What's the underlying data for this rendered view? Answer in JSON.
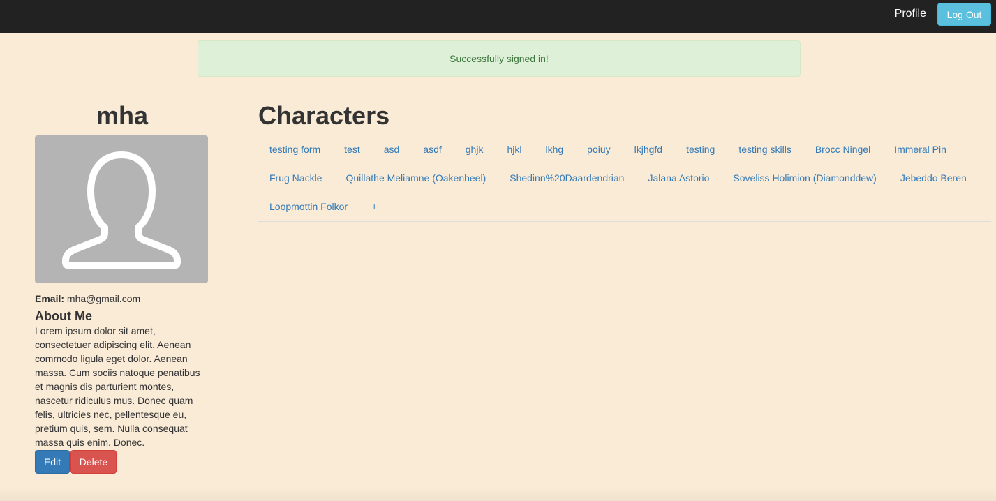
{
  "navbar": {
    "profile_label": "Profile",
    "logout_label": "Log Out"
  },
  "alert": {
    "message": "Successfully signed in!"
  },
  "profile": {
    "username": "mha",
    "email_label": "Email:",
    "email": "mha@gmail.com",
    "about_title": "About Me",
    "about_text": "Lorem ipsum dolor sit amet, consectetuer adipiscing elit. Aenean commodo ligula eget dolor. Aenean massa. Cum sociis natoque penatibus et magnis dis parturient montes, nascetur ridiculus mus. Donec quam felis, ultricies nec, pellentesque eu, pretium quis, sem. Nulla consequat massa quis enim. Donec.",
    "edit_label": "Edit",
    "delete_label": "Delete",
    "avatar_icon": "user-silhouette-icon"
  },
  "characters": {
    "title": "Characters",
    "tabs": [
      "testing form",
      "test",
      "asd",
      "asdf",
      "ghjk",
      "hjkl",
      "lkhg",
      "poiuy",
      "lkjhgfd",
      "testing",
      "testing skills",
      "Brocc Ningel",
      "Immeral Pin",
      "Frug Nackle",
      "Quillathe Meliamne (Oakenheel)",
      "Shedinn%20Daardendrian",
      "Jalana Astorio",
      "Soveliss Holimion (Diamonddew)",
      "Jebeddo Beren",
      "Loopmottin Folkor"
    ],
    "add_label": "+"
  },
  "colors": {
    "page_background": "#faebd7",
    "navbar": "#222222",
    "link": "#337ab7",
    "info_button": "#5bc0de",
    "primary_button": "#337ab7",
    "danger_button": "#d9534f",
    "alert_success_bg": "#dff0d8",
    "alert_success_text": "#3c763d"
  }
}
